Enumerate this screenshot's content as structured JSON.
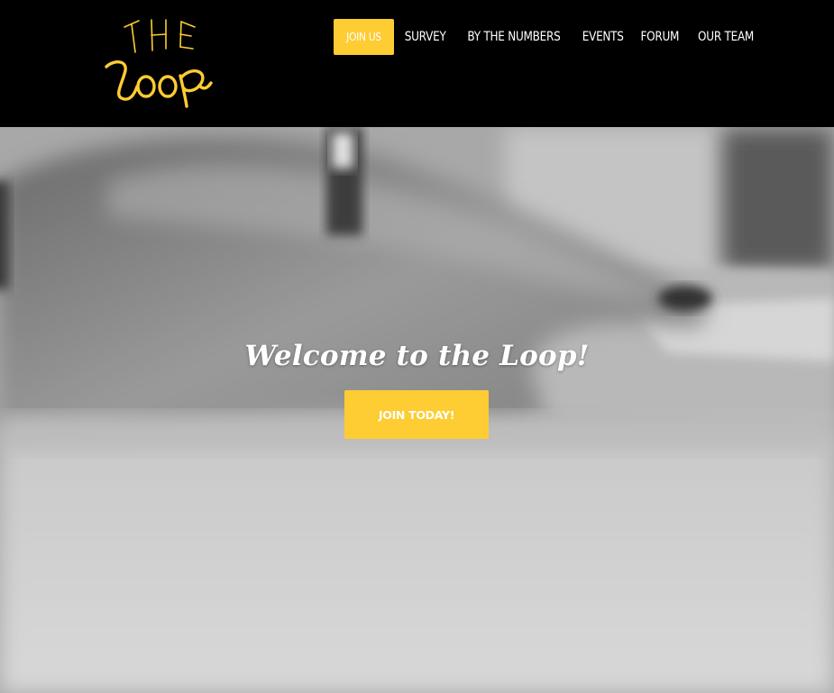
{
  "brand": {
    "logo_line1": "THE",
    "logo_line2": "Loop",
    "accent_color": "#fecc33"
  },
  "nav": {
    "items": [
      {
        "label": "JOIN US",
        "active": true
      },
      {
        "label": "SURVEY"
      },
      {
        "label": "BY THE NUMBERS"
      },
      {
        "label": "EVENTS"
      },
      {
        "label": "FORUM"
      },
      {
        "label": "OUR TEAM"
      }
    ]
  },
  "hero": {
    "background_image": "grayscale photo of hands typing on a keyboard",
    "title": "Welcome to the Loop!",
    "cta_label": "JOIN TODAY!"
  }
}
